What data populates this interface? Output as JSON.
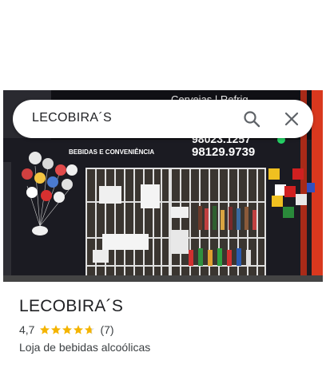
{
  "search": {
    "query": "LECOBIRA´S"
  },
  "photo": {
    "sign_top_text": "Cervejas | Refrig...",
    "phone_1": "98023.1257",
    "phone_2": "98129.9739",
    "sign_sub_text": "BEBIDAS E CONVENIÊNCIA"
  },
  "place": {
    "name": "LECOBIRA´S",
    "rating": "4,7",
    "rating_value": 4.7,
    "review_count": "(7)",
    "category": "Loja de bebidas alcoólicas"
  },
  "colors": {
    "star": "#f4b400",
    "star_empty": "#dadce0"
  }
}
